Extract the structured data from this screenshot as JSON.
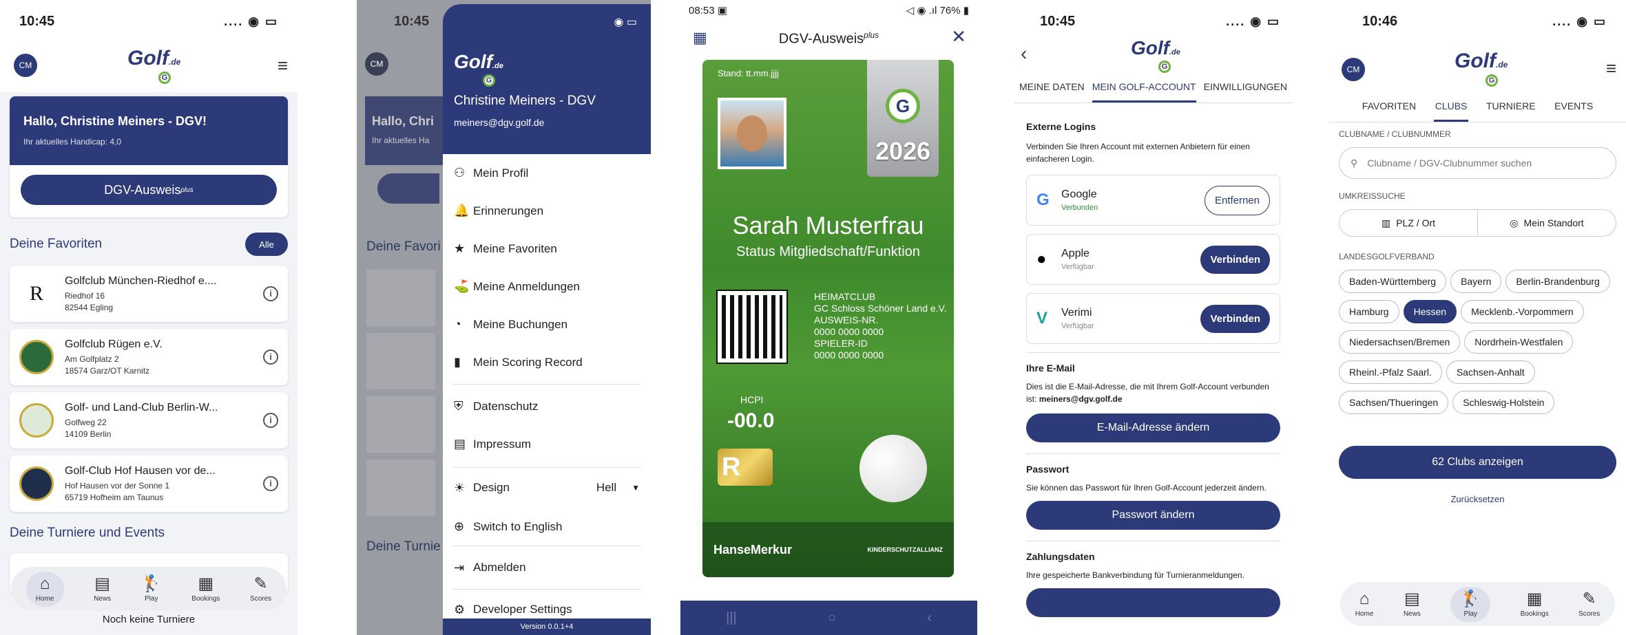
{
  "s1": {
    "time": "10:45",
    "avatar": "CM",
    "greeting": "Hallo, Christine Meiners - DGV!",
    "handicap": "Ihr aktuelles Handicap: 4,0",
    "ausweis_btn": "DGV-Ausweis",
    "ausweis_sup": "plus",
    "fav_title": "Deine Favoriten",
    "fav_all": "Alle",
    "favorites": [
      {
        "name": "Golfclub München-Riedhof e....",
        "l1": "Riedhof 16",
        "l2": "82544 Egling",
        "logo": "R"
      },
      {
        "name": "Golfclub Rügen e.V.",
        "l1": "Am Golfplatz 2",
        "l2": "18574 Garz/OT Karnitz",
        "logo": ""
      },
      {
        "name": "Golf- und Land-Club Berlin-W...",
        "l1": "Golfweg 22",
        "l2": "14109 Berlin",
        "logo": ""
      },
      {
        "name": "Golf-Club Hof Hausen vor de...",
        "l1": "Hof Hausen vor der Sonne 1",
        "l2": "65719 Hofheim am Taunus",
        "logo": ""
      }
    ],
    "events_title": "Deine Turniere und Events",
    "no_events": "Noch keine Turniere",
    "tabs": [
      "Home",
      "News",
      "Play",
      "Bookings",
      "Scores"
    ]
  },
  "s2": {
    "time": "10:45",
    "avatar": "CM",
    "bg_greeting": "Hallo, Chri",
    "bg_handicap": "Ihr aktuelles Ha",
    "bg_fav": "Deine Favori",
    "bg_events": "Deine Turnie",
    "user_name": "Christine Meiners - DGV",
    "user_email": "meiners@dgv.golf.de",
    "menu": [
      {
        "icon": "person-gear-icon",
        "glyph": "⚇",
        "label": "Mein Profil"
      },
      {
        "icon": "bell-icon",
        "glyph": "🔔",
        "label": "Erinnerungen"
      },
      {
        "icon": "star-icon",
        "glyph": "★",
        "label": "Meine Favoriten"
      },
      {
        "icon": "golfer-icon",
        "glyph": "⛳",
        "label": "Meine Anmeldungen"
      },
      {
        "icon": "clock-icon",
        "glyph": "◔",
        "label": "Meine Buchungen"
      },
      {
        "icon": "bar-chart-icon",
        "glyph": "▮",
        "label": "Mein Scoring Record"
      },
      {
        "icon": "shield-icon",
        "glyph": "⛨",
        "label": "Datenschutz"
      },
      {
        "icon": "document-icon",
        "glyph": "▤",
        "label": "Impressum"
      }
    ],
    "design_label": "Design",
    "design_value": "Hell",
    "switch_lang": "Switch to English",
    "logout": "Abmelden",
    "dev_settings": "Developer Settings",
    "version": "Version 0.0.1+4"
  },
  "s3": {
    "time": "08:53",
    "battery": "76%",
    "title": "DGV-Ausweis",
    "title_sup": "plus",
    "stand": "Stand: tt.mm.jjjj",
    "year": "2026",
    "name": "Sarah Musterfrau",
    "status": "Status Mitgliedschaft/Funktion",
    "homeclub_label": "HEIMATCLUB",
    "homeclub": "GC Schloss Schöner Land e.V.",
    "id_label": "AUSWEIS-NR.",
    "id": "0000 0000 0000",
    "player_label": "SPIELER-ID",
    "player": "0000 0000 0000",
    "hcpi_label": "HCPI",
    "hcpi": "-00.0",
    "r_badge": "R",
    "sponsor1": "HanseMerkur",
    "sponsor2": "KINDERSCHUTZALLIANZ"
  },
  "s4": {
    "time": "10:45",
    "tabs": [
      "MEINE DATEN",
      "MEIN GOLF-ACCOUNT",
      "EINWILLIGUNGEN"
    ],
    "ext_title": "Externe Logins",
    "ext_desc": "Verbinden Sie Ihren Account mit externen Anbietern für einen einfacheren Login.",
    "providers": [
      {
        "name": "Google",
        "status": "Verbunden",
        "action": "Entfernen",
        "glyph": "G"
      },
      {
        "name": "Apple",
        "status": "Verfügbar",
        "action": "Verbinden",
        "glyph": ""
      },
      {
        "name": "Verimi",
        "status": "Verfügbar",
        "action": "Verbinden",
        "glyph": "V"
      }
    ],
    "email_title": "Ihre E-Mail",
    "email_desc": "Dies ist die E-Mail-Adresse, die mit Ihrem Golf-Account verbunden ist:",
    "email": "meiners@dgv.golf.de",
    "email_btn": "E-Mail-Adresse ändern",
    "pw_title": "Passwort",
    "pw_desc": "Sie können das Passwort für Ihren Golf-Account jederzeit ändern.",
    "pw_btn": "Passwort ändern",
    "pay_title": "Zahlungsdaten",
    "pay_desc": "Ihre gespeicherte Bankverbindung für Turnieranmeldungen."
  },
  "s5": {
    "time": "10:46",
    "avatar": "CM",
    "tabs": [
      "FAVORITEN",
      "CLUBS",
      "TURNIERE",
      "EVENTS"
    ],
    "name_label": "CLUBNAME / CLUBNUMMER",
    "search_placeholder": "Clubname / DGV-Clubnummer suchen",
    "radius_label": "UMKREISSUCHE",
    "plz": "PLZ / Ort",
    "standort": "Mein Standort",
    "lgv_label": "LANDESGOLFVERBAND",
    "regions": [
      "Baden-Württemberg",
      "Bayern",
      "Berlin-Brandenburg",
      "Hamburg",
      "Hessen",
      "Mecklenb.-Vorpommern",
      "Niedersachsen/Bremen",
      "Nordrhein-Westfalen",
      "Rheinl.-Pfalz Saarl.",
      "Sachsen-Anhalt",
      "Sachsen/Thueringen",
      "Schleswig-Holstein"
    ],
    "selected_region": "Hessen",
    "show_btn": "62 Clubs anzeigen",
    "reset": "Zurücksetzen",
    "tabbar": [
      "Home",
      "News",
      "Play",
      "Bookings",
      "Scores"
    ]
  },
  "logo_text": "Golf",
  "logo_sub": ".de",
  "colors": {
    "navy": "#2c3a7a",
    "green": "#6cb33f"
  }
}
